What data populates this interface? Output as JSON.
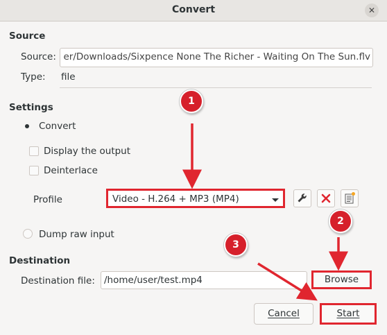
{
  "window": {
    "title": "Convert"
  },
  "source": {
    "heading": "Source",
    "source_label": "Source:",
    "source_value": "er/Downloads/Sixpence None The Richer - Waiting On The Sun.flv",
    "type_label": "Type:",
    "type_value": "file"
  },
  "settings": {
    "heading": "Settings",
    "convert_label": "Convert",
    "display_output_label": "Display the output",
    "deinterlace_label": "Deinterlace",
    "profile_label": "Profile",
    "profile_value": "Video - H.264 + MP3 (MP4)",
    "dump_raw_label": "Dump raw input"
  },
  "destination": {
    "heading": "Destination",
    "file_label": "Destination file:",
    "file_value": "/home/user/test.mp4",
    "browse_label": "Browse"
  },
  "buttons": {
    "cancel_label": "Cancel",
    "start_label": "Start"
  },
  "annotations": {
    "badge1": "1",
    "badge2": "2",
    "badge3": "3"
  },
  "colors": {
    "highlight": "#e0262f",
    "badge": "#d6202b"
  },
  "icons": [
    "close-icon",
    "wrench-icon",
    "delete-x-icon",
    "new-profile-icon",
    "caret-down-icon"
  ]
}
